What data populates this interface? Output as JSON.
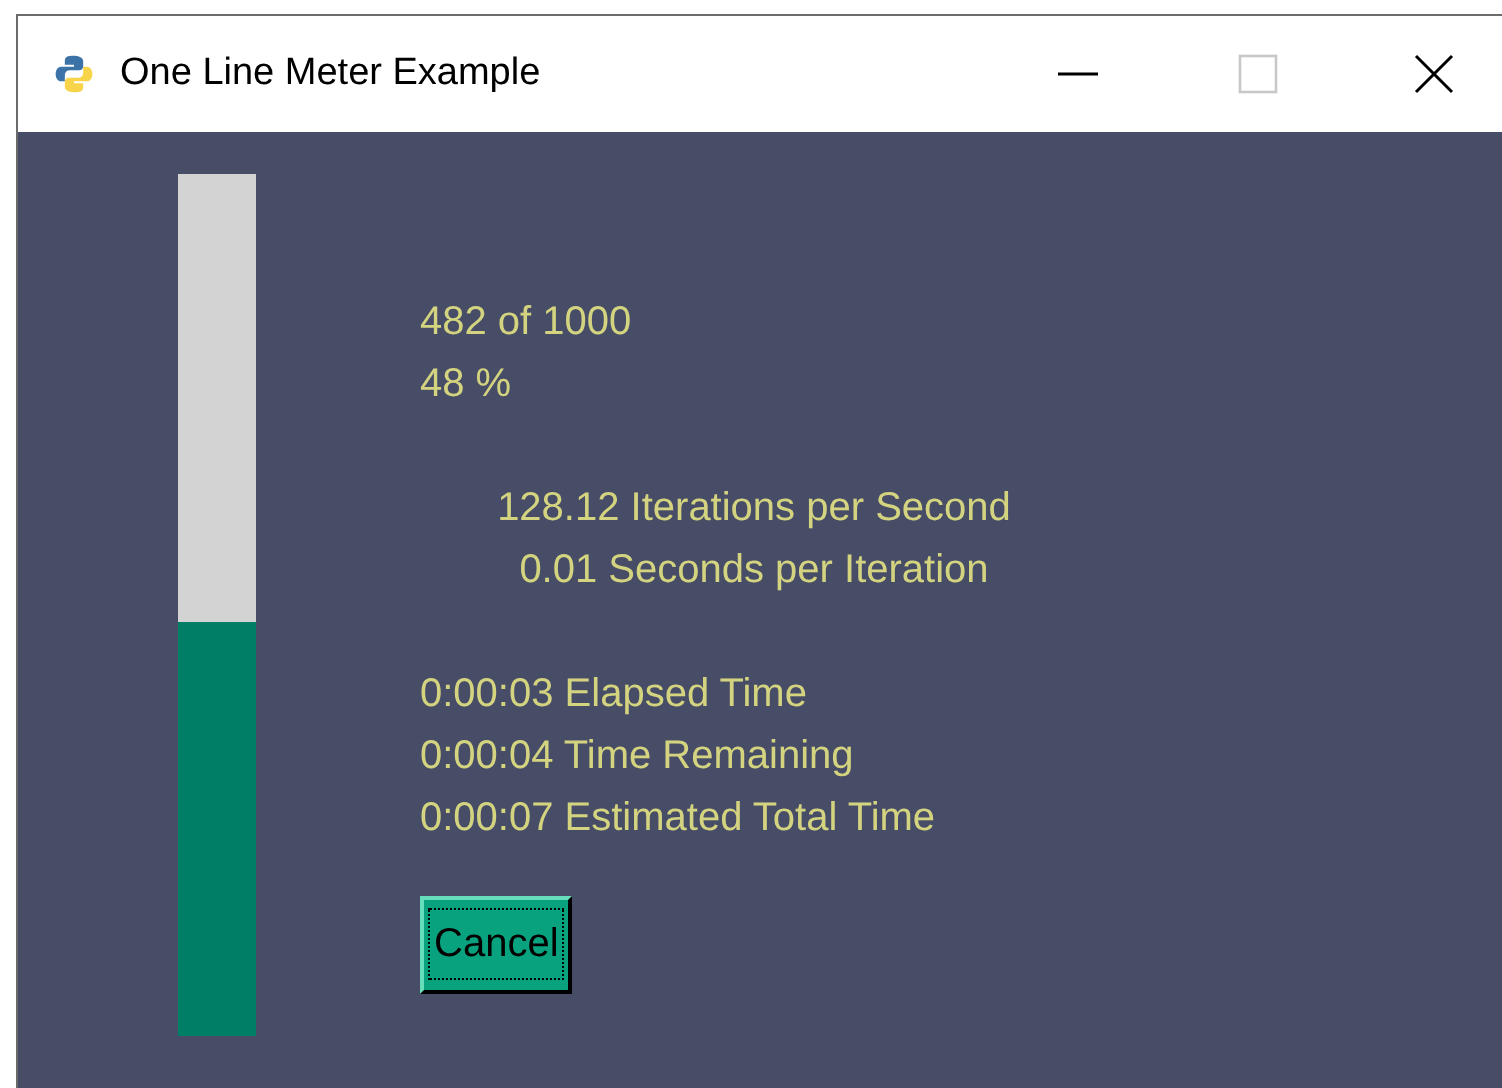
{
  "window": {
    "title": "One Line Meter Example"
  },
  "meter": {
    "level": 0.48
  },
  "stats": [
    [
      "482 of 1000",
      "48 %"
    ],
    [
      "128.12 Iterations per Second",
      "0.01 Seconds per Iteration"
    ],
    [
      "0:00:03 Elapsed Time",
      "0:00:04 Time Remaining",
      "0:00:07 Estimated Total Time"
    ]
  ],
  "buttons": [
    "Cancel"
  ]
}
